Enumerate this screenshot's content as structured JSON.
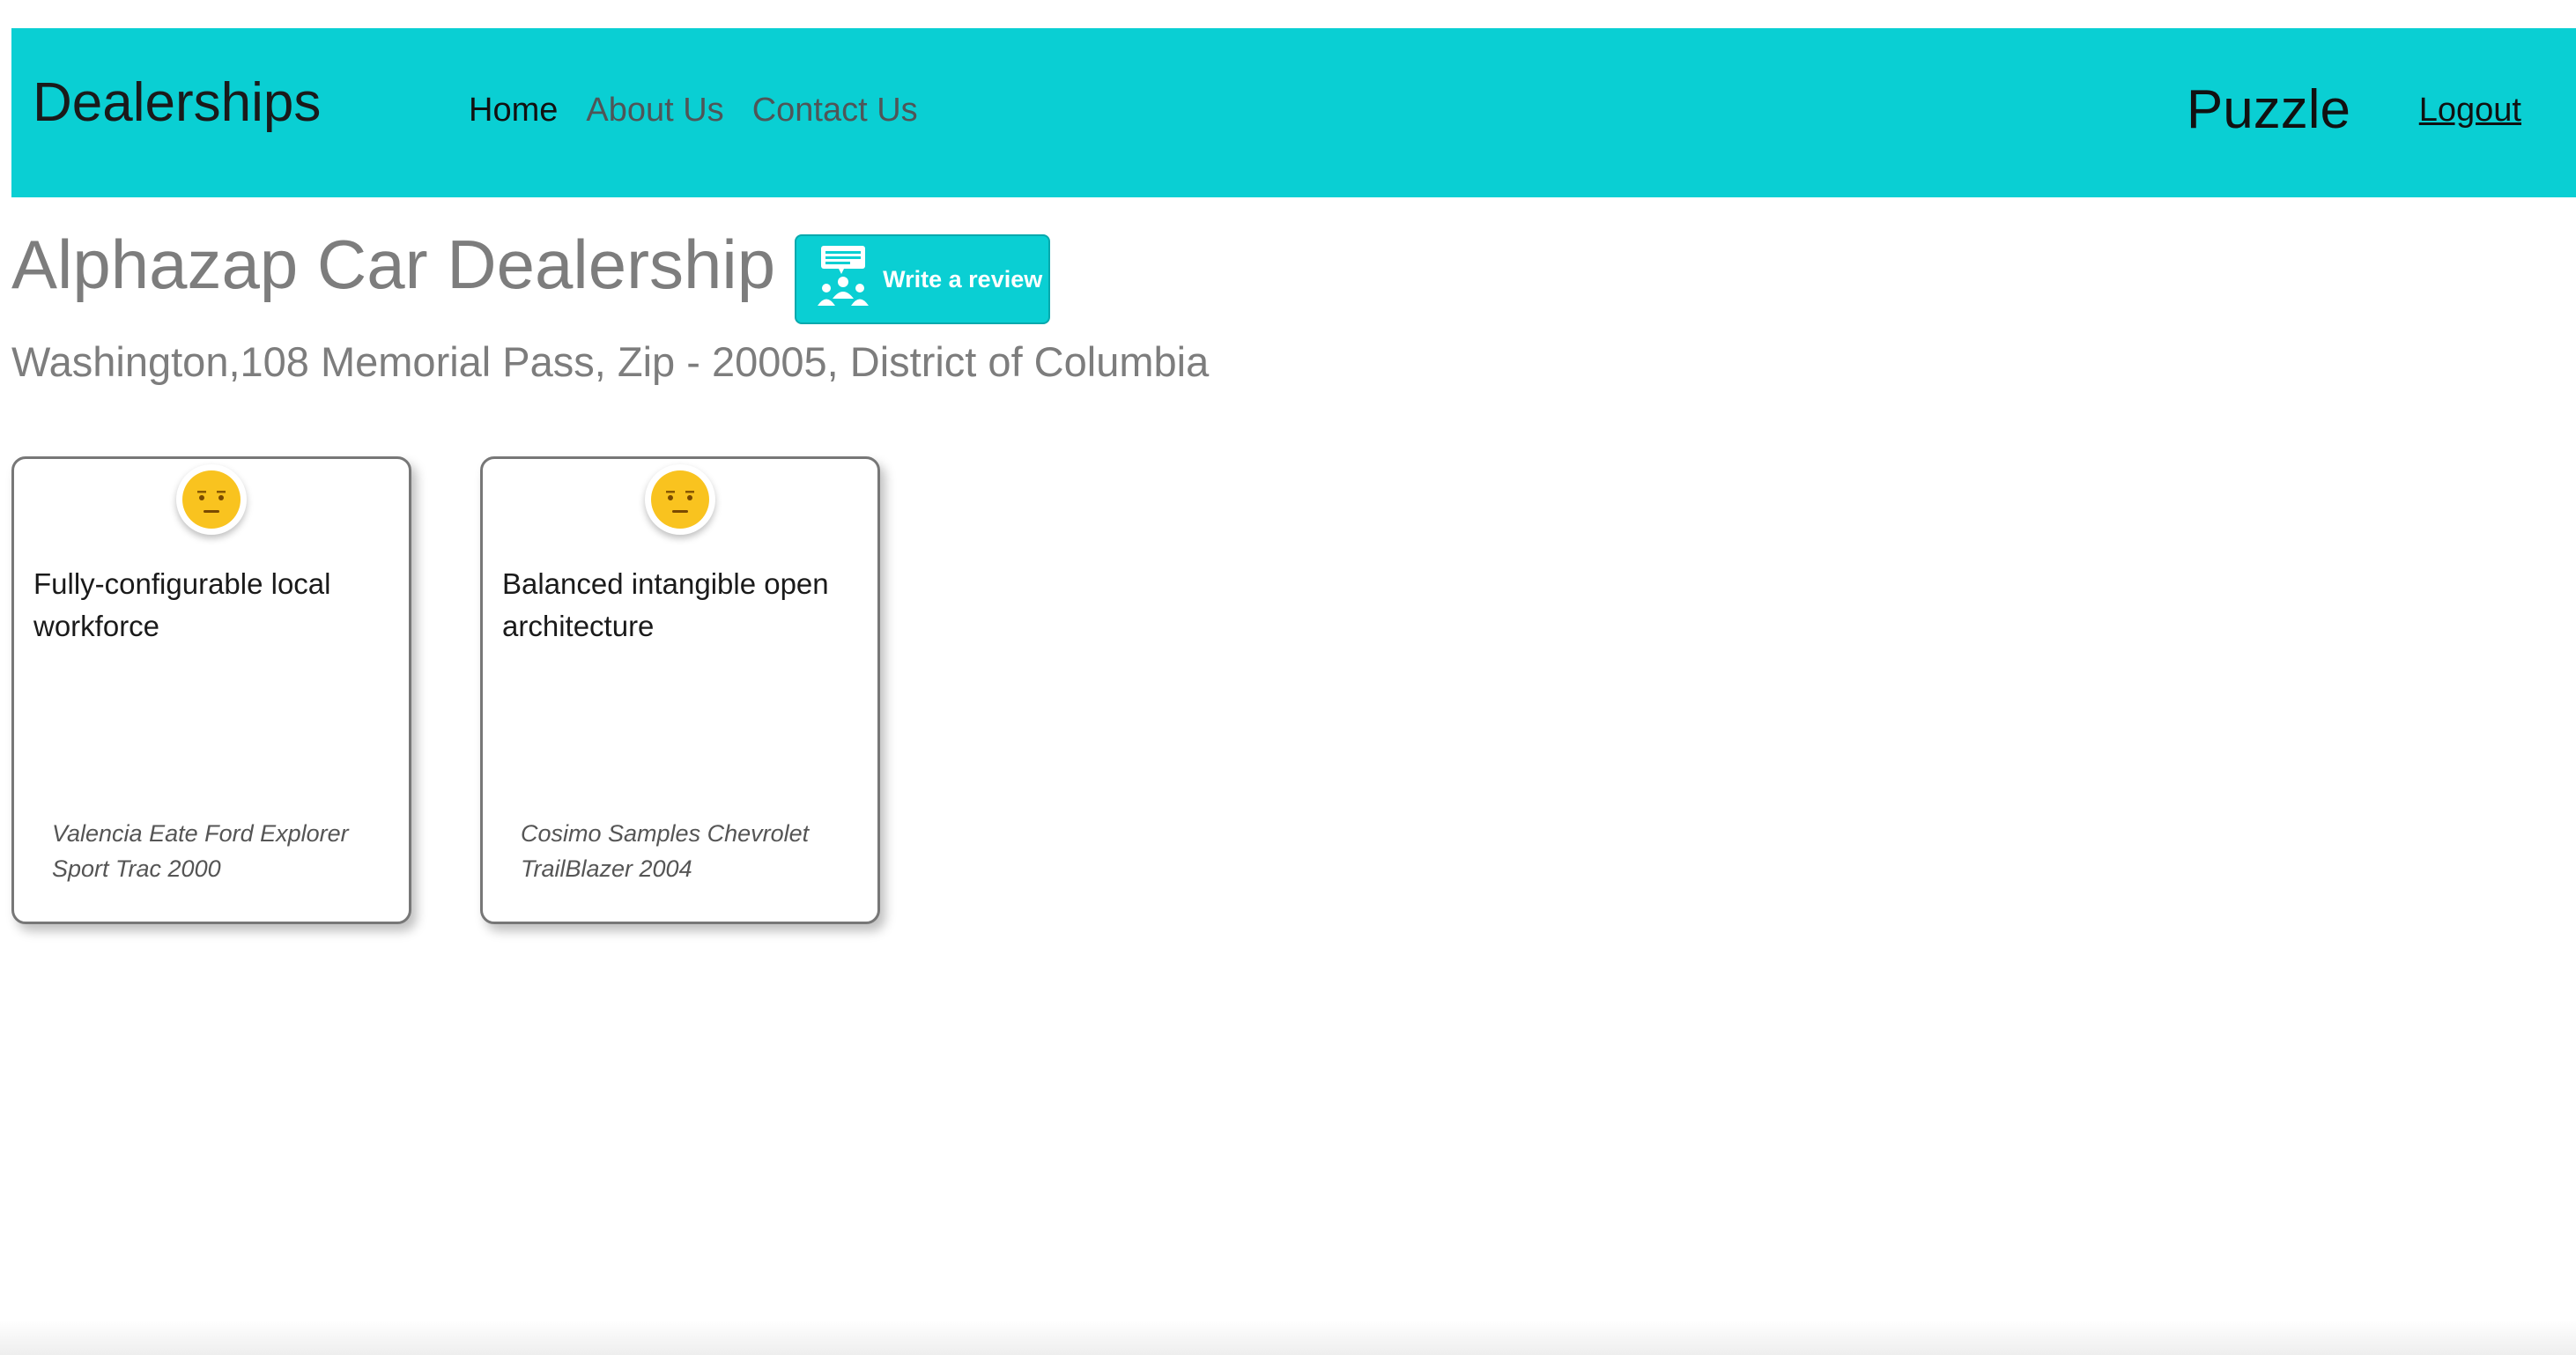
{
  "navbar": {
    "brand": "Dealerships",
    "links": [
      "Home",
      "About Us",
      "Contact Us"
    ],
    "active_link": "Home",
    "username": "Puzzle",
    "logout_label": "Logout",
    "background_color": "#0acfd3"
  },
  "dealer": {
    "name": "Alphazap Car Dealership",
    "address": "Washington,108 Memorial Pass, Zip - 20005, District of Columbia",
    "review_button_label": "Write a review",
    "review_button_icon": "people-speech-bubble-icon"
  },
  "reviews": [
    {
      "sentiment_icon": "neutral-face-icon",
      "text": "Fully-configurable local workforce",
      "reviewer": "Valencia Eate Ford Explorer Sport Trac 2000"
    },
    {
      "sentiment_icon": "neutral-face-icon",
      "text": "Balanced intangible open architecture",
      "reviewer": "Cosimo Samples Chevrolet TrailBlazer 2004"
    }
  ]
}
